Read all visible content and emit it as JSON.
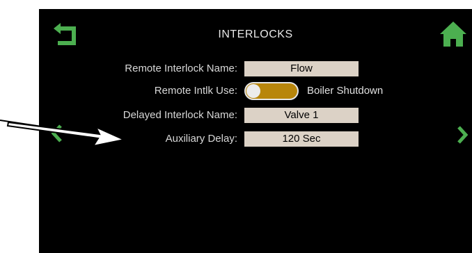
{
  "header": {
    "title": "INTERLOCKS"
  },
  "settings": [
    {
      "label": "Remote Interlock Name:",
      "value": "Flow"
    },
    {
      "label": "Remote Intlk Use:",
      "value": "Boiler Shutdown"
    },
    {
      "label": "Delayed Interlock Name:",
      "value": "Valve 1"
    },
    {
      "label": "Auxiliary Delay:",
      "value": "120 Sec"
    }
  ],
  "colors": {
    "accent": "#4caf50",
    "toggle": "#b8860b",
    "field_bg": "#dcd2c6",
    "screen_bg": "#000000"
  },
  "icons": {
    "back": "back-arrow-icon",
    "home": "home-icon",
    "prev": "chevron-left-icon",
    "next": "chevron-right-icon"
  }
}
